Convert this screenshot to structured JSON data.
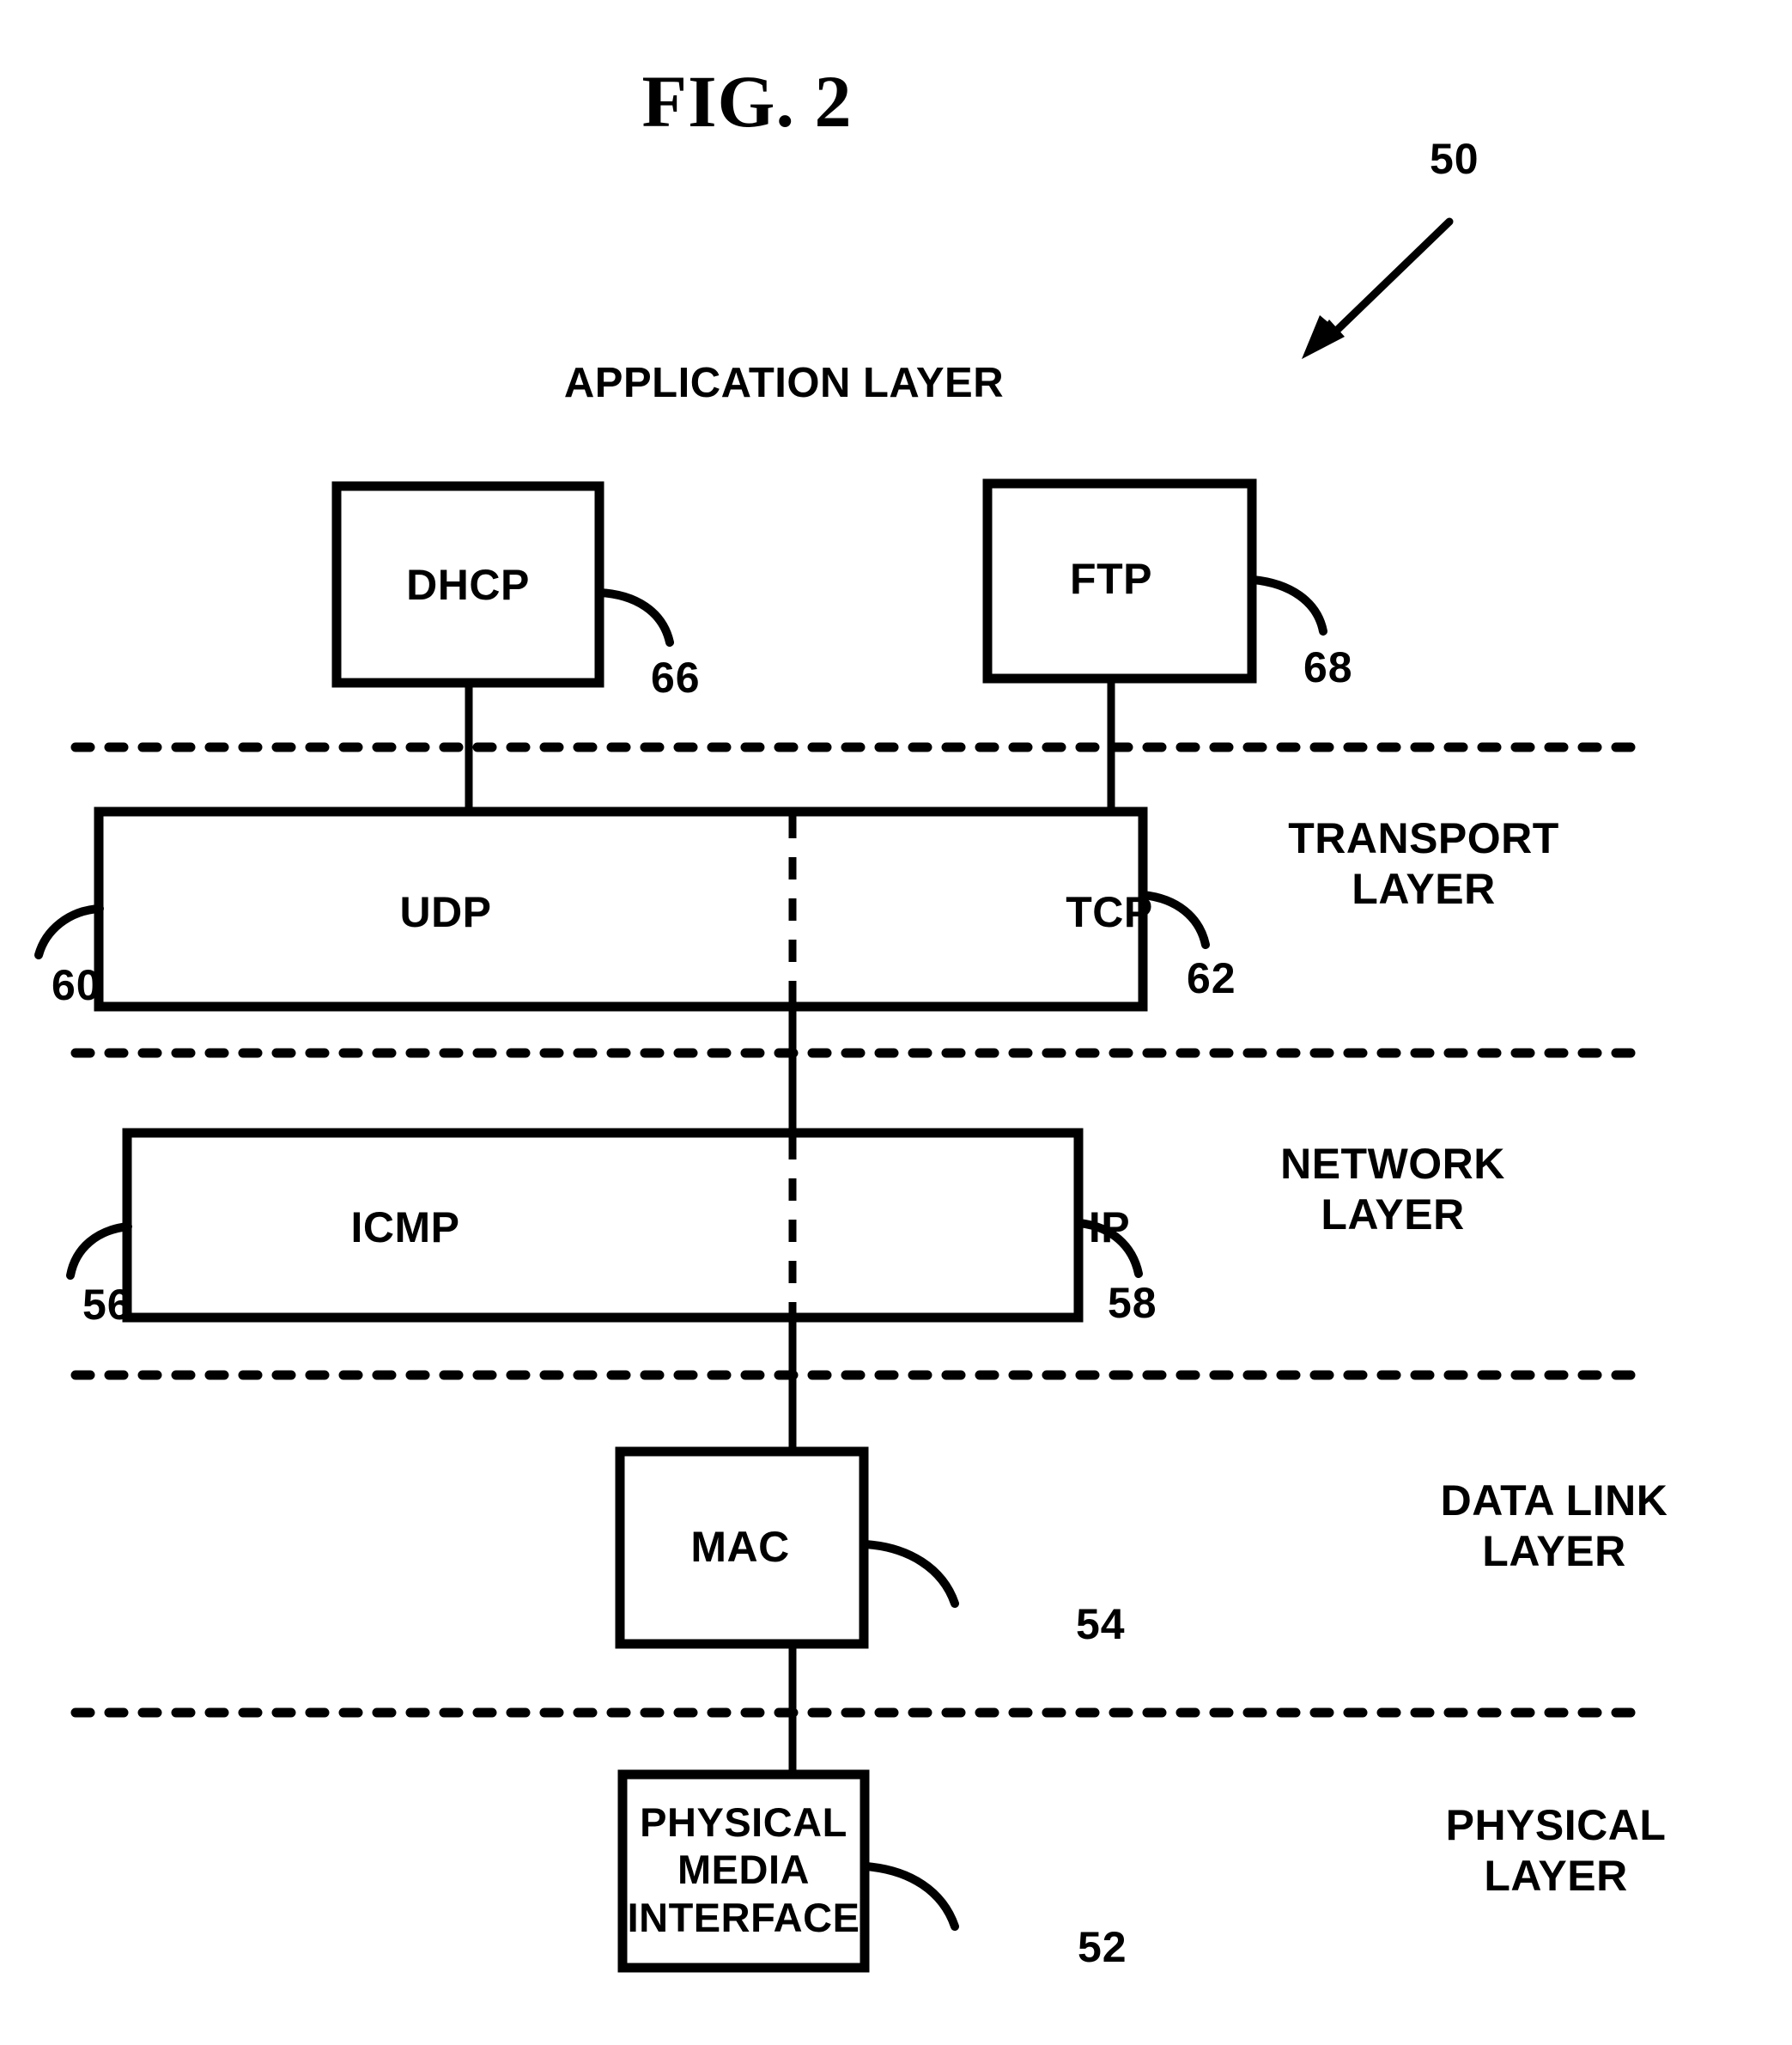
{
  "figure": {
    "title": "FIG. 2",
    "system_ref": "50"
  },
  "layer_headings": {
    "application": "APPLICATION LAYER"
  },
  "side_labels": [
    {
      "id": "transport",
      "line1": "TRANSPORT",
      "line2": "LAYER"
    },
    {
      "id": "network",
      "line1": "NETWORK",
      "line2": "LAYER"
    },
    {
      "id": "datalink",
      "line1": "DATA LINK",
      "line2": "LAYER"
    },
    {
      "id": "physical",
      "line1": "PHYSICAL",
      "line2": "LAYER"
    }
  ],
  "blocks": {
    "dhcp": {
      "label": "DHCP",
      "ref": "66"
    },
    "ftp": {
      "label": "FTP",
      "ref": "68"
    },
    "udp": {
      "label": "UDP",
      "ref": "60"
    },
    "tcp": {
      "label": "TCP",
      "ref": "62"
    },
    "icmp": {
      "label": "ICMP",
      "ref": "56"
    },
    "ip": {
      "label": "IP",
      "ref": "58"
    },
    "mac": {
      "label": "MAC",
      "ref": "54"
    },
    "pmi": {
      "label_line1": "PHYSICAL",
      "label_line2": "MEDIA",
      "label_line3": "INTERFACE",
      "ref": "52"
    }
  },
  "colors": {
    "ink": "#000000",
    "paper": "#ffffff"
  }
}
